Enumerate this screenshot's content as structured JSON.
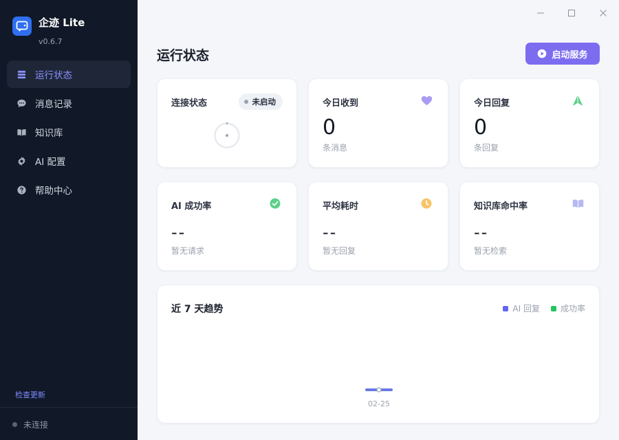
{
  "app": {
    "name": "企迹 Lite",
    "version": "v0.6.7"
  },
  "nav": [
    {
      "label": "运行状态",
      "icon": "dashboard-icon",
      "active": true
    },
    {
      "label": "消息记录",
      "icon": "chat-icon",
      "active": false
    },
    {
      "label": "知识库",
      "icon": "book-icon",
      "active": false
    },
    {
      "label": "AI 配置",
      "icon": "gear-icon",
      "active": false
    },
    {
      "label": "帮助中心",
      "icon": "help-icon",
      "active": false
    }
  ],
  "sidebar": {
    "update_label": "检查更新",
    "connection_label": "未连接"
  },
  "page": {
    "title": "运行状态",
    "start_button": "启动服务"
  },
  "cards": {
    "connection": {
      "label": "连接状态",
      "badge": "未启动"
    },
    "received": {
      "label": "今日收到",
      "value": "0",
      "sub": "条消息"
    },
    "replied": {
      "label": "今日回复",
      "value": "0",
      "sub": "条回复"
    },
    "ai_success": {
      "label": "AI 成功率",
      "value": "--",
      "sub": "暂无请求"
    },
    "avg_time": {
      "label": "平均耗时",
      "value": "--",
      "sub": "暂无回复"
    },
    "kb_hit": {
      "label": "知识库命中率",
      "value": "--",
      "sub": "暂无检索"
    }
  },
  "colors": {
    "accent": "#7c6cf0",
    "heart": "#a99cf5",
    "reply": "#5ccf8a",
    "success": "#5ccf8a",
    "clock": "#f7c46a",
    "book": "#b5b9f4",
    "series_ai": "#6366f1",
    "series_rate": "#22c55e"
  },
  "chart_data": {
    "type": "line",
    "title": "近 7 天趋势",
    "x": [
      "02-25"
    ],
    "series": [
      {
        "name": "AI 回复",
        "values": [
          0
        ]
      },
      {
        "name": "成功率",
        "values": [
          0
        ]
      }
    ]
  }
}
